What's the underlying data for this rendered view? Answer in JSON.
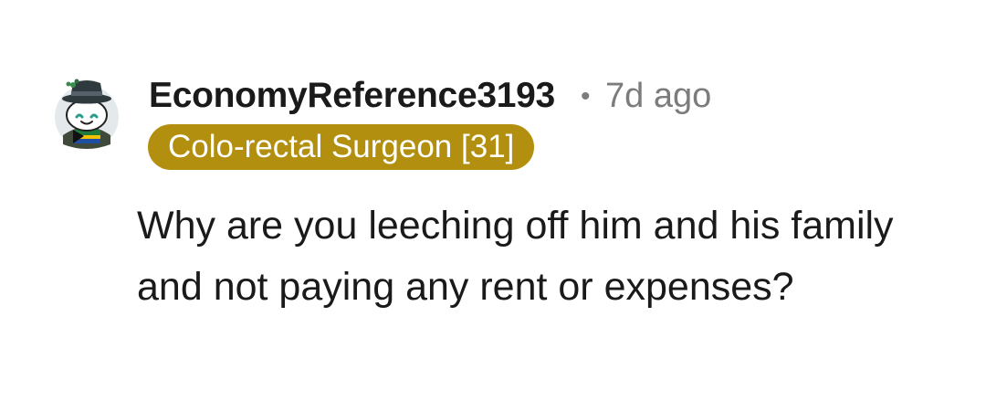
{
  "comment": {
    "author": "EconomyReference3193",
    "separator": "•",
    "age": "7d ago",
    "flair": "Colo-rectal Surgeon [31]",
    "text": "Why are you leeching off him and his family and not paying any rent or expenses?"
  },
  "avatar": {
    "icon": "snoo-avatar-icon",
    "background_color": "#e4e9ec"
  },
  "colors": {
    "flair_background": "#b38f10",
    "flair_text": "#ffffff",
    "username": "#1a1a1b",
    "meta": "#7c7c7c",
    "body": "#1a1a1b"
  }
}
